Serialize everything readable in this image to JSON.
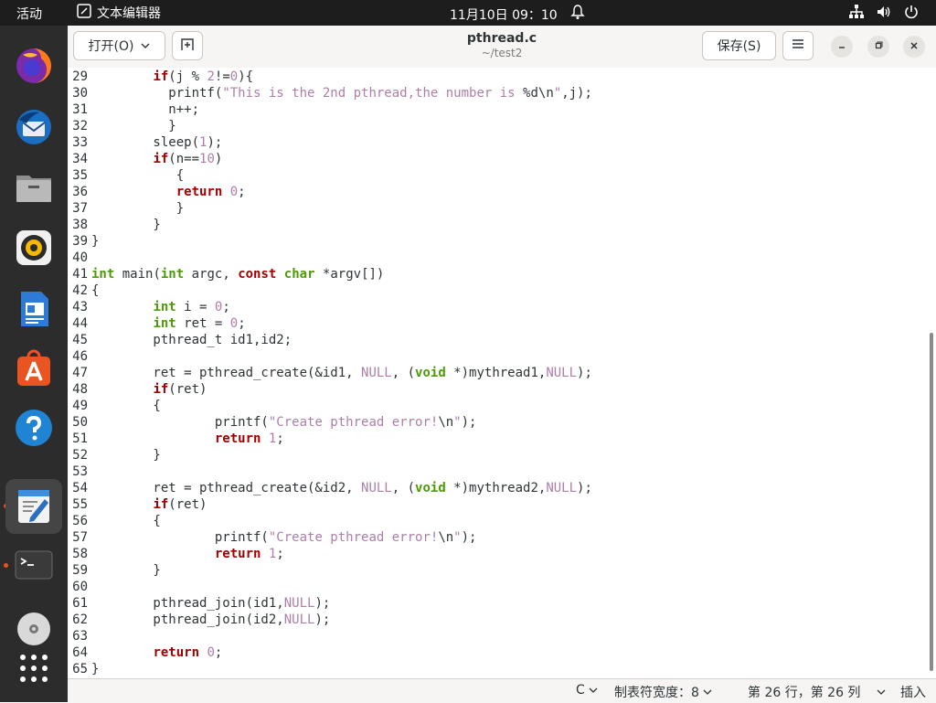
{
  "topbar": {
    "activities": "活动",
    "app_name": "文本编辑器",
    "clock": "11月10日  09：10"
  },
  "dock": {
    "items": [
      "firefox-icon",
      "thunderbird-icon",
      "files-icon",
      "rhythmbox-icon",
      "libreoffice-writer-icon",
      "app-center-icon",
      "help-icon",
      "text-editor-icon",
      "terminal-icon",
      "dvd-icon",
      "show-apps-icon"
    ]
  },
  "header": {
    "open_label": "打开(O)",
    "title": "pthread.c",
    "subtitle": "~/test2",
    "save_label": "保存(S)"
  },
  "editor": {
    "lines": [
      {
        "n": "29",
        "t": "        if(j % 2!=0){"
      },
      {
        "n": "30",
        "t": "          printf(\"This is the 2nd pthread,the number is %d\\n\",j);"
      },
      {
        "n": "31",
        "t": "          n++;"
      },
      {
        "n": "32",
        "t": "          }"
      },
      {
        "n": "33",
        "t": "        sleep(1);"
      },
      {
        "n": "34",
        "t": "        if(n==10)"
      },
      {
        "n": "35",
        "t": "           {"
      },
      {
        "n": "36",
        "t": "           return 0;"
      },
      {
        "n": "37",
        "t": "           }"
      },
      {
        "n": "38",
        "t": "        }"
      },
      {
        "n": "39",
        "t": "}"
      },
      {
        "n": "40",
        "t": ""
      },
      {
        "n": "41",
        "t": "int main(int argc, const char *argv[])"
      },
      {
        "n": "42",
        "t": "{"
      },
      {
        "n": "43",
        "t": "        int i = 0;"
      },
      {
        "n": "44",
        "t": "        int ret = 0;"
      },
      {
        "n": "45",
        "t": "        pthread_t id1,id2;"
      },
      {
        "n": "46",
        "t": ""
      },
      {
        "n": "47",
        "t": "        ret = pthread_create(&id1, NULL, (void *)mythread1,NULL);"
      },
      {
        "n": "48",
        "t": "        if(ret)"
      },
      {
        "n": "49",
        "t": "        {"
      },
      {
        "n": "50",
        "t": "                printf(\"Create pthread error!\\n\");"
      },
      {
        "n": "51",
        "t": "                return 1;"
      },
      {
        "n": "52",
        "t": "        }"
      },
      {
        "n": "53",
        "t": ""
      },
      {
        "n": "54",
        "t": "        ret = pthread_create(&id2, NULL, (void *)mythread2,NULL);"
      },
      {
        "n": "55",
        "t": "        if(ret)"
      },
      {
        "n": "56",
        "t": "        {"
      },
      {
        "n": "57",
        "t": "                printf(\"Create pthread error!\\n\");"
      },
      {
        "n": "58",
        "t": "                return 1;"
      },
      {
        "n": "59",
        "t": "        }"
      },
      {
        "n": "60",
        "t": ""
      },
      {
        "n": "61",
        "t": "        pthread_join(id1,NULL);"
      },
      {
        "n": "62",
        "t": "        pthread_join(id2,NULL);"
      },
      {
        "n": "63",
        "t": ""
      },
      {
        "n": "64",
        "t": "        return 0;"
      },
      {
        "n": "65",
        "t": "}"
      }
    ]
  },
  "statusbar": {
    "language": "C",
    "tab_width": "制表符宽度：8",
    "position": "第 26 行，第 26 列",
    "mode": "插入"
  },
  "colors": {
    "keyword": "#a40000",
    "type": "#4e9a06",
    "literal": "#ad7fa8",
    "accent": "#e95420"
  }
}
